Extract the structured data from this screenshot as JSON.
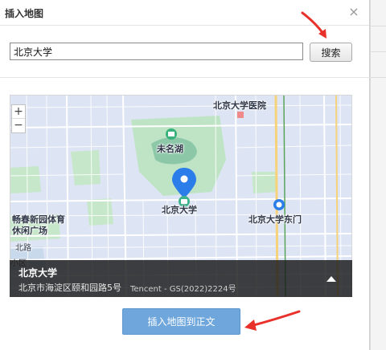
{
  "dialog": {
    "title": "插入地图",
    "close_glyph": "×"
  },
  "search": {
    "value": "北京大学",
    "button_label": "搜索"
  },
  "map": {
    "zoom_in": "+",
    "zoom_out": "−",
    "pois": {
      "hospital": "北京大学医院",
      "lake": "未名湖",
      "university": "北京大学",
      "east_gate": "北京大学东门",
      "garden_line1": "畅春新园体育",
      "garden_line2": "休闲广场",
      "road": "北路",
      "district": "小区"
    },
    "info": {
      "name": "北京大学",
      "address": "北京市海淀区颐和园路5号",
      "copyright": "Tencent - GS(2022)2224号"
    }
  },
  "footer": {
    "insert_label": "插入地图到正文"
  },
  "colors": {
    "accent_button": "#6fa7dc",
    "annotation_arrow": "#e8312a",
    "marker": "#2b7de9"
  }
}
